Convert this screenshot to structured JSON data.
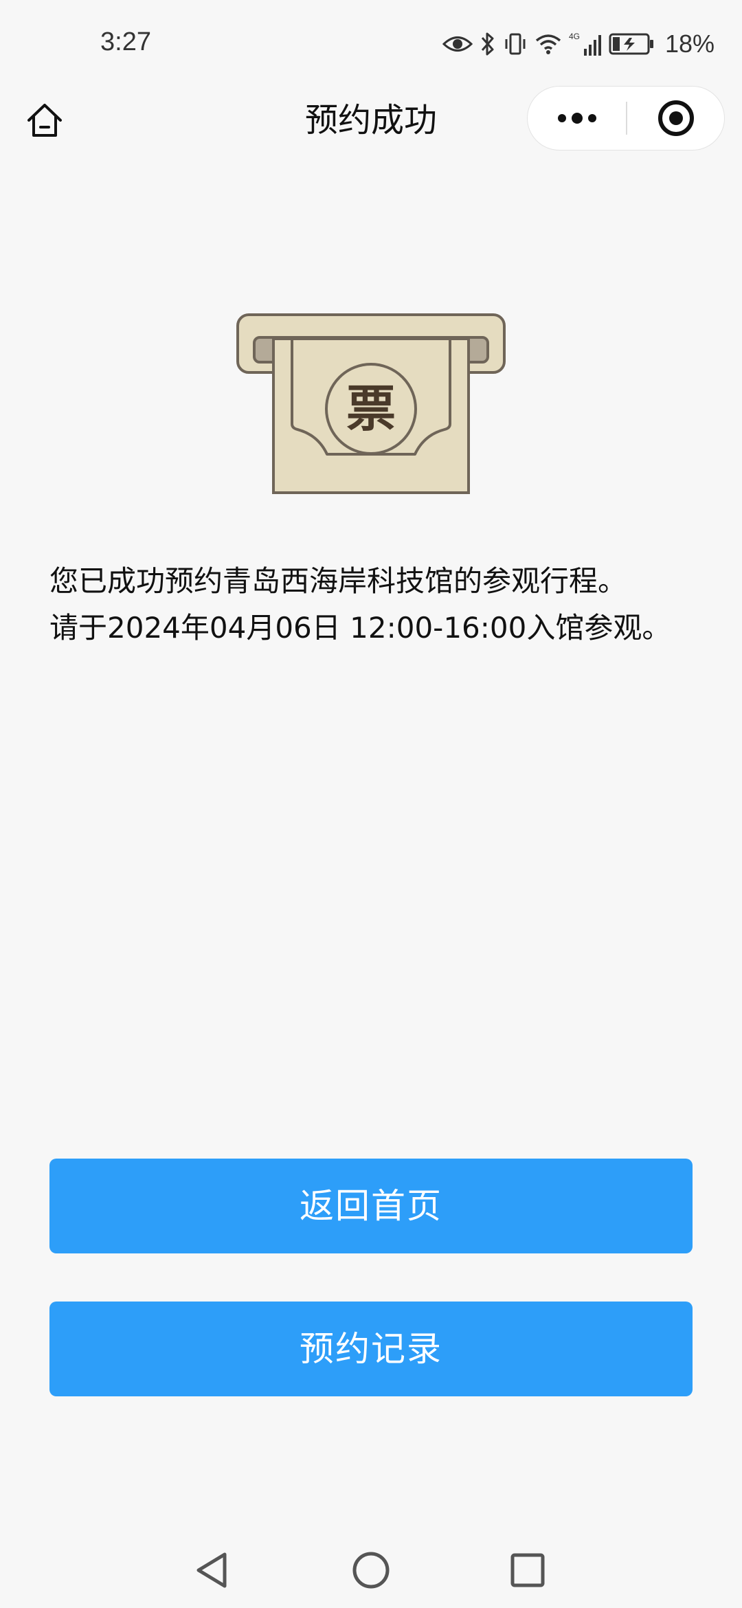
{
  "status_bar": {
    "time": "3:27",
    "network": "4G",
    "battery": "18%",
    "icons": [
      "eye-icon",
      "bluetooth-icon",
      "vibrate-icon",
      "wifi-icon",
      "signal-icon",
      "battery-icon"
    ]
  },
  "nav": {
    "title": "预约成功",
    "home_icon": "home-icon",
    "more_icon": "more-icon",
    "close_icon": "miniprogram-close-icon"
  },
  "ticket": {
    "char": "票"
  },
  "message": {
    "line1": "您已成功预约青岛西海岸科技馆的参观行程。",
    "line2": "请于2024年04月06日 12:00-16:00入馆参观。"
  },
  "buttons": {
    "home": "返回首页",
    "records": "预约记录"
  },
  "colors": {
    "background": "#f7f7f7",
    "button": "#2d9ef9",
    "ticket_fill": "#e5dcc0",
    "ticket_stroke": "#6f6558"
  },
  "system_nav": [
    "back-icon",
    "home-circle-icon",
    "recents-icon"
  ]
}
